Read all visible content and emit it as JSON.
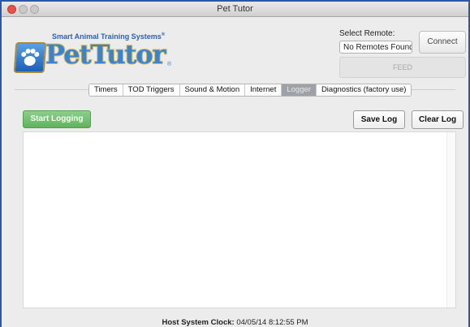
{
  "window": {
    "title": "Pet Tutor"
  },
  "logo": {
    "tagline": "Smart Animal Training Systems",
    "tagline_mark": "®",
    "brand": "PetTutor",
    "brand_mark": "®"
  },
  "remote": {
    "label": "Select Remote:",
    "selected": "No Remotes Found ↕",
    "connect_label": "Connect",
    "feed_label": "FEED"
  },
  "tabs": [
    {
      "label": "Timers",
      "active": false
    },
    {
      "label": "TOD Triggers",
      "active": false
    },
    {
      "label": "Sound & Motion",
      "active": false
    },
    {
      "label": "Internet",
      "active": false
    },
    {
      "label": "Logger",
      "active": true
    },
    {
      "label": "Diagnostics (factory use)",
      "active": false
    }
  ],
  "logger": {
    "start_label": "Start Logging",
    "save_label": "Save Log",
    "clear_label": "Clear Log",
    "log_text": ""
  },
  "footer": {
    "clock_label": "Host System Clock:",
    "clock_value": "04/05/14 8:12:55 PM"
  },
  "colors": {
    "window_border": "#2d55a8",
    "start_button": "#6fbf6d",
    "brand_blue": "#3a82d4",
    "brand_gold": "#d9b94a"
  }
}
